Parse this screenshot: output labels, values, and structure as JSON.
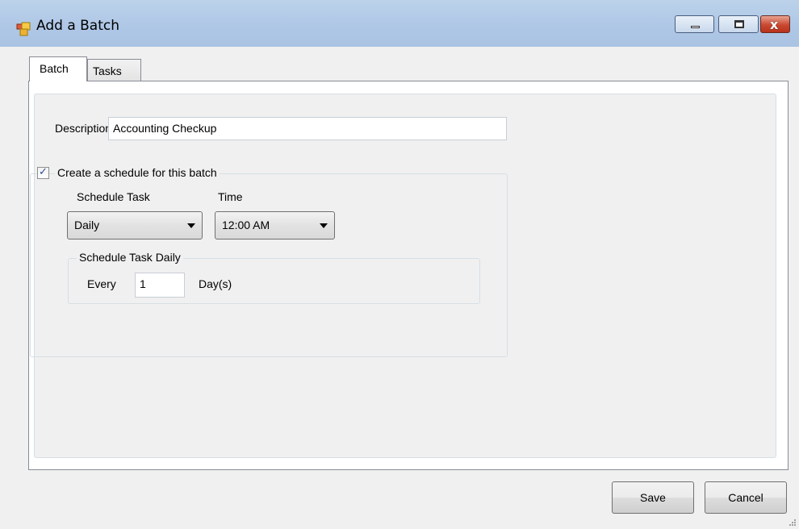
{
  "window": {
    "title": "Add a Batch",
    "icon": "app-window-icon",
    "controls": {
      "minimize_icon": "minimize-icon",
      "maximize_icon": "maximize-icon",
      "close_glyph": "x",
      "close_color": "#c9482f"
    }
  },
  "tabs": [
    {
      "label": "Batch",
      "active": true
    },
    {
      "label": "Tasks",
      "active": false
    }
  ],
  "batch_tab": {
    "description_label": "Description",
    "description_value": "Accounting Checkup",
    "schedule_checkbox_label": "Create a schedule for this batch",
    "schedule_checked": true,
    "schedule_task_label": "Schedule Task",
    "schedule_task_value": "Daily",
    "time_label": "Time",
    "time_value": "12:00 AM",
    "daily_group_caption": "Schedule Task Daily",
    "every_label": "Every",
    "every_value": "1",
    "days_label": "Day(s)"
  },
  "footer": {
    "save_label": "Save",
    "cancel_label": "Cancel"
  },
  "colors": {
    "titlebar": "#aec7e6",
    "background": "#f0f0f0",
    "close_button": "#c9482f"
  }
}
